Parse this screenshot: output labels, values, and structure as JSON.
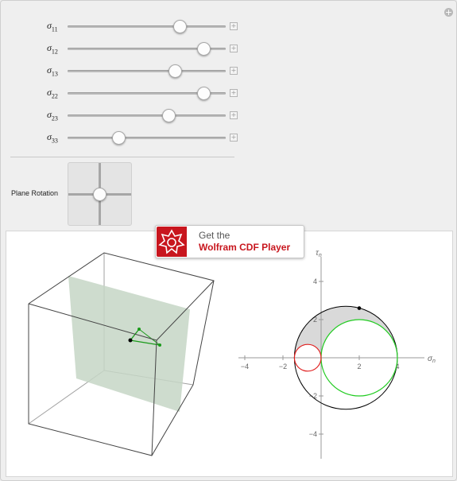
{
  "controls": {
    "expand_label": "+",
    "sliders": [
      {
        "symbol": "σ",
        "subscript": "11",
        "level": 0.71
      },
      {
        "symbol": "σ",
        "subscript": "12",
        "level": 0.86
      },
      {
        "symbol": "σ",
        "subscript": "13",
        "level": 0.68
      },
      {
        "symbol": "σ",
        "subscript": "22",
        "level": 0.86
      },
      {
        "symbol": "σ",
        "subscript": "23",
        "level": 0.64
      },
      {
        "symbol": "σ",
        "subscript": "33",
        "level": 0.32
      }
    ],
    "add_label": "+",
    "plane_rotation_label": "Plane Rotation"
  },
  "cdf_badge": {
    "line1": "Get the",
    "line2": "Wolfram CDF Player"
  },
  "colors": {
    "plane": "#c6d6c6",
    "vector": "#1a9a1a",
    "green_circle": "#22cc22",
    "red_circle": "#e02020",
    "shaded_region": "#d9d9d9"
  },
  "chart_data": {
    "type": "scatter",
    "xlabel": "σ",
    "xlabel_sub": "n",
    "ylabel": "τ",
    "ylabel_sub": "n",
    "xlim": [
      -5,
      5
    ],
    "ylim": [
      -5,
      5
    ],
    "x_ticks": [
      -4,
      -2,
      2,
      4
    ],
    "y_ticks": [
      -4,
      -2,
      2,
      4
    ],
    "x_tick_labels": [
      "−4",
      "−2",
      "2",
      "4"
    ],
    "y_tick_labels": [
      "−4",
      "−2",
      "2",
      "4"
    ],
    "circles": [
      {
        "name": "outer",
        "center": [
          1.3,
          0
        ],
        "radius": 2.7,
        "color": "#000000"
      },
      {
        "name": "green",
        "center": [
          2.0,
          0
        ],
        "radius": 2.0,
        "color": "#22cc22"
      },
      {
        "name": "red",
        "center": [
          -0.7,
          0
        ],
        "radius": 0.7,
        "color": "#e02020"
      }
    ],
    "point": [
      2.0,
      2.6
    ]
  }
}
